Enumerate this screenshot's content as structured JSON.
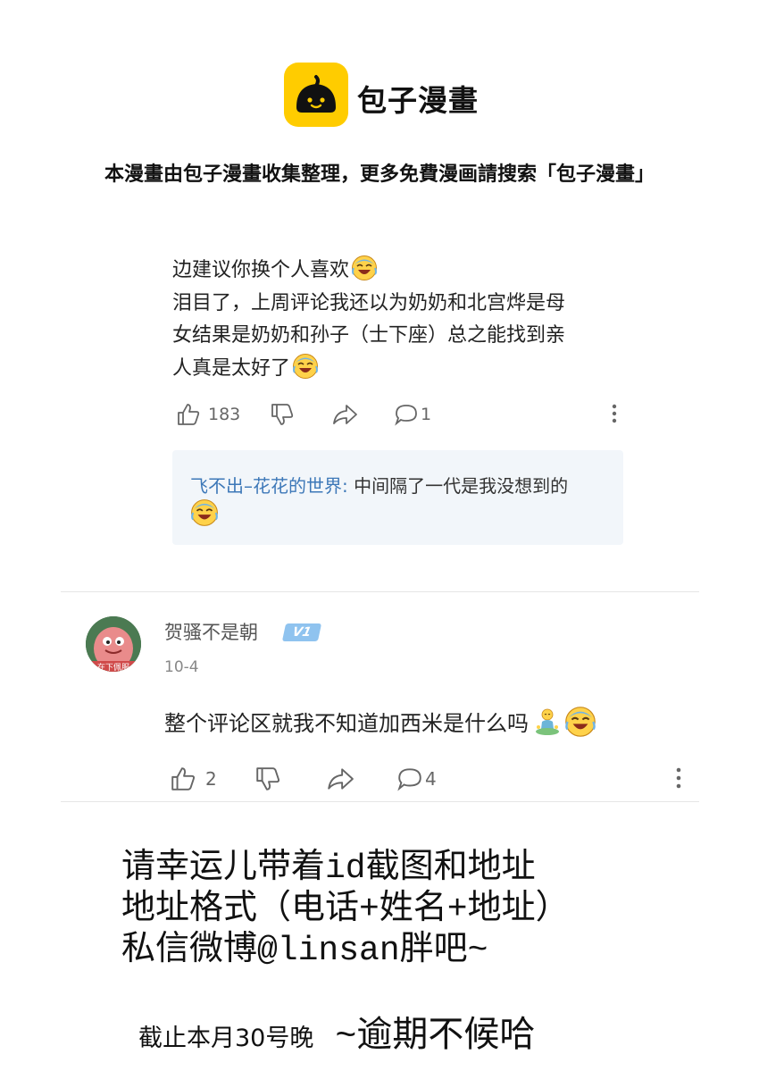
{
  "header": {
    "logo_text": "包子漫畫",
    "tagline": "本漫畫由包子漫畫收集整理，更多免費漫画請搜索「包子漫畫」"
  },
  "comment1": {
    "lines": [
      "边建议你换个人喜欢",
      "泪目了，上周评论我还以为奶奶和北宫烨是母",
      "女结果是奶奶和孙子（士下座）总之能找到亲",
      "人真是太好了"
    ],
    "like_count": "183",
    "reply_count": "1",
    "reply": {
      "author": "飞不出–花花的世界:",
      "text": " 中间隔了一代是我没想到的"
    }
  },
  "comment2": {
    "username": "贺骚不是朝",
    "badge": "V1",
    "avatar_caption": "在下佩服",
    "date": "10-4",
    "text": "整个评论区就我不知道加西米是什么吗",
    "like_count": "2",
    "reply_count": "4"
  },
  "notice": {
    "lines": [
      "请幸运儿带着id截图和地址",
      "地址格式（电话+姓名+地址）",
      "私信微博@linsan胖吧~"
    ],
    "deadline_a": "截止本月30号晚",
    "deadline_b": " ~逾期不候哈"
  },
  "icons": [
    "baozi-logo-icon",
    "laughing-crying-emoji-icon",
    "thumbs-up-icon",
    "thumbs-down-icon",
    "share-icon",
    "comment-icon",
    "more-icon",
    "meditating-emoji-icon"
  ],
  "colors": {
    "brand_yellow": "#ffcc00",
    "link_blue": "#3d78b8",
    "badge_blue": "#8fc3ef"
  }
}
